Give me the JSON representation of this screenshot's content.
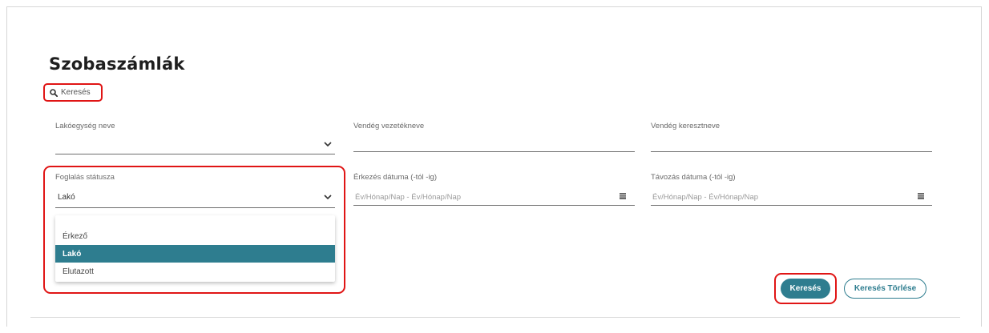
{
  "page": {
    "title": "Szobaszámlák"
  },
  "search_toggle": {
    "label": "Keresés",
    "icon": "search-icon"
  },
  "fields": {
    "unit_name": {
      "label": "Lakóegység neve",
      "value": ""
    },
    "guest_lastname": {
      "label": "Vendég vezetékneve",
      "value": ""
    },
    "guest_firstname": {
      "label": "Vendég keresztneve",
      "value": ""
    },
    "booking_status": {
      "label": "Foglalás státusza",
      "value": "Lakó"
    },
    "arrival_date": {
      "label": "Érkezés dátuma (-tól -ig)",
      "placeholder": "Év/Hónap/Nap - Év/Hónap/Nap"
    },
    "departure_date": {
      "label": "Távozás dátuma (-tól -ig)",
      "placeholder": "Év/Hónap/Nap - Év/Hónap/Nap"
    }
  },
  "status_dropdown": {
    "options": [
      "Érkező",
      "Lakó",
      "Elutazott"
    ],
    "selected": "Lakó"
  },
  "buttons": {
    "search": "Keresés",
    "clear": "Keresés Törlése"
  },
  "colors": {
    "accent": "#2e7d8f",
    "highlight": "#e01515"
  }
}
